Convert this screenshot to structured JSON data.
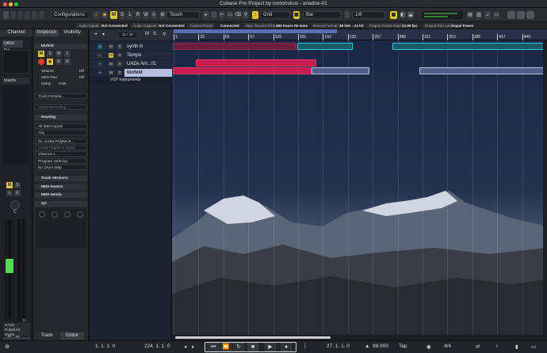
{
  "window": {
    "title": "Cubase Pro Project by nortonvirus - ariadne-01"
  },
  "toolbar": {
    "configurations": "Configurations",
    "m": "M",
    "s": "S",
    "l": "L",
    "r": "R",
    "w": "W",
    "a": "A",
    "automation_mode": "Touch",
    "grid_type": "Grid",
    "grid_unit": "Bar",
    "quantize": "1/8"
  },
  "status": {
    "audio_inputs_label": "Audio Inputs",
    "audio_inputs_value": "Not Connected",
    "audio_outputs_label": "Audio Outputs",
    "audio_outputs_value": "Not Connected",
    "control_room_label": "Control Room",
    "control_room_value": "Connected",
    "max_record_label": "Max. Record Time",
    "max_record_value": "380 hours 09 mins",
    "record_format_label": "Record Format",
    "record_format_value": "48 kHz - 24 bit",
    "frame_rate_label": "Project Frame Rate",
    "frame_rate_value": "23.98 fps",
    "pan_law_label": "Project Pan Law",
    "pan_law_value": "Equal Power"
  },
  "channel": {
    "tab": "Channel",
    "name": "UADx Pol...",
    "inserts": "Inserts",
    "m": "M",
    "s": "S",
    "l": "L",
    "e": "E",
    "r": "R",
    "w": "W",
    "letter_c": "C",
    "meter_left": "-6.17",
    "meter_right": "-0.0",
    "bottom_label": "UADx PolyMAX Synth",
    "bottom_num": "9"
  },
  "inspector": {
    "tab_inspector": "Inspector",
    "tab_visibility": "Visibility",
    "track_name": "blofeld",
    "m": "M",
    "s": "S",
    "w": "W",
    "l": "L",
    "r": "R",
    "e": "E",
    "volume_label": "Volume",
    "volume_value": "Off",
    "midi_pan_label": "MIDI Pan",
    "midi_pan_value": "Off",
    "delay_label": "Delay",
    "delay_value": "0.00",
    "track_presets": "Track Presets...",
    "insert_recording": "Insert Recording...",
    "routing": "Routing",
    "all_midi_inputs": "All MIDI Inputs",
    "any": "Any",
    "synth_1": "01. UADx PolyMAX...",
    "synth_2": "UADx PolyMAX Synth",
    "midi_channel": "Channel 1",
    "program_selector": "Program Selector",
    "drum_map": "No Drum Map",
    "track_versions": "Track Versions",
    "midi_inserts": "MIDI Inserts",
    "midi_sends": "MIDI Sends",
    "qc": "QC"
  },
  "tracklist": {
    "counter": "11 / 18",
    "tracks": [
      {
        "name": "synth iii",
        "m": "M",
        "s": "S"
      },
      {
        "name": "Tempo",
        "m": "M",
        "s": "S"
      },
      {
        "name": "UADx Anl...01",
        "m": "M",
        "s": "S"
      },
      {
        "name": "blofeld",
        "m": "M",
        "s": "S"
      }
    ],
    "folder": "VST Instruments"
  },
  "ruler": {
    "ticks": [
      "1",
      "33",
      "65",
      "97",
      "129",
      "161",
      "193",
      "225",
      "257",
      "289",
      "321",
      "353",
      "385",
      "417",
      "449"
    ]
  },
  "left_zone_tabs": {
    "track": "Track",
    "editor": "Editor"
  },
  "transport": {
    "position_left": "1. 1. 1. 0",
    "position_right": "224. 1. 1. 0",
    "primary_time": "27. 1. 1. 0",
    "tempo": "98.000",
    "tempo_mode": "Tap",
    "signature": "4/4"
  },
  "colors": {
    "accent_yellow": "#e2c33c",
    "record_red": "#d9412c",
    "part_red": "#c71c4f",
    "part_cyan": "#37c6d9",
    "part_lavender": "#b9c2e6",
    "selected_track": "#b6bfe0"
  }
}
